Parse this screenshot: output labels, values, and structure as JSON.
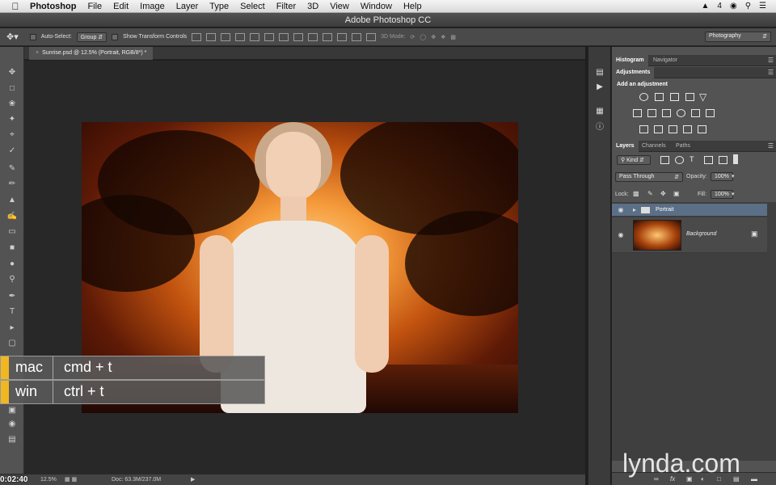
{
  "menubar": {
    "app": "Photoshop",
    "items": [
      "File",
      "Edit",
      "Image",
      "Layer",
      "Type",
      "Select",
      "Filter",
      "3D",
      "View",
      "Window",
      "Help"
    ],
    "status_count": "4"
  },
  "window": {
    "title": "Adobe Photoshop CC"
  },
  "options_bar": {
    "auto_select_label": "Auto-Select:",
    "auto_select_value": "Group",
    "show_transform_label": "Show Transform Controls",
    "mode_3d_label": "3D Mode:",
    "workspace": "Photography"
  },
  "document": {
    "tab_title": "Sunrise.psd @ 12.5% (Portrait, RGB/8*) *"
  },
  "shortcut": {
    "mac_label": "mac",
    "mac_keys": "cmd + t",
    "win_label": "win",
    "win_keys": "ctrl + t"
  },
  "status_bar": {
    "timer": "0:02:40",
    "zoom": "12.5%",
    "doc_size": "Doc: 63.3M/237.0M"
  },
  "panels": {
    "top_tabs": [
      "Histogram",
      "Navigator"
    ],
    "adjustments": {
      "tab": "Adjustments",
      "heading": "Add an adjustment"
    },
    "layers": {
      "tabs": [
        "Layers",
        "Channels",
        "Paths"
      ],
      "filter_kind": "Kind",
      "blend_mode": "Pass Through",
      "opacity_label": "Opacity:",
      "opacity_value": "100%",
      "lock_label": "Lock:",
      "fill_label": "Fill:",
      "fill_value": "100%",
      "items": [
        {
          "name": "Portrait"
        },
        {
          "name": "Background"
        }
      ]
    }
  },
  "watermark": "lynda.com"
}
